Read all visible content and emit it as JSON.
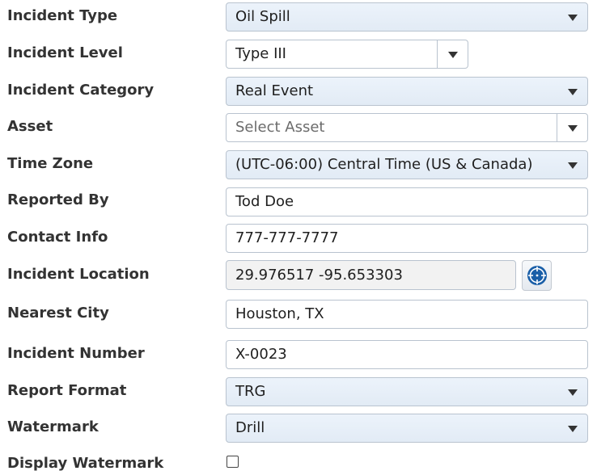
{
  "fields": {
    "incident_type": {
      "label": "Incident Type",
      "value": "Oil Spill"
    },
    "incident_level": {
      "label": "Incident Level",
      "value": "Type III"
    },
    "incident_category": {
      "label": "Incident Category",
      "value": "Real Event"
    },
    "asset": {
      "label": "Asset",
      "placeholder": "Select Asset"
    },
    "time_zone": {
      "label": "Time Zone",
      "value": "(UTC-06:00) Central Time (US & Canada)"
    },
    "reported_by": {
      "label": "Reported By",
      "value": "Tod Doe"
    },
    "contact_info": {
      "label": "Contact Info",
      "value": "777-777-7777"
    },
    "incident_location": {
      "label": "Incident Location",
      "value": "29.976517 -95.653303",
      "button_icon": "crosshair-icon"
    },
    "nearest_city": {
      "label": "Nearest City",
      "value": "Houston, TX"
    },
    "incident_number": {
      "label": "Incident Number",
      "value": "X-0023"
    },
    "report_format": {
      "label": "Report Format",
      "value": "TRG"
    },
    "watermark": {
      "label": "Watermark",
      "value": "Drill"
    },
    "display_watermark": {
      "label": "Display Watermark",
      "checked": false
    }
  },
  "colors": {
    "icon_blue": "#1a5fa8",
    "select_bg": "#e6eef8",
    "border": "#b9c3cf"
  }
}
